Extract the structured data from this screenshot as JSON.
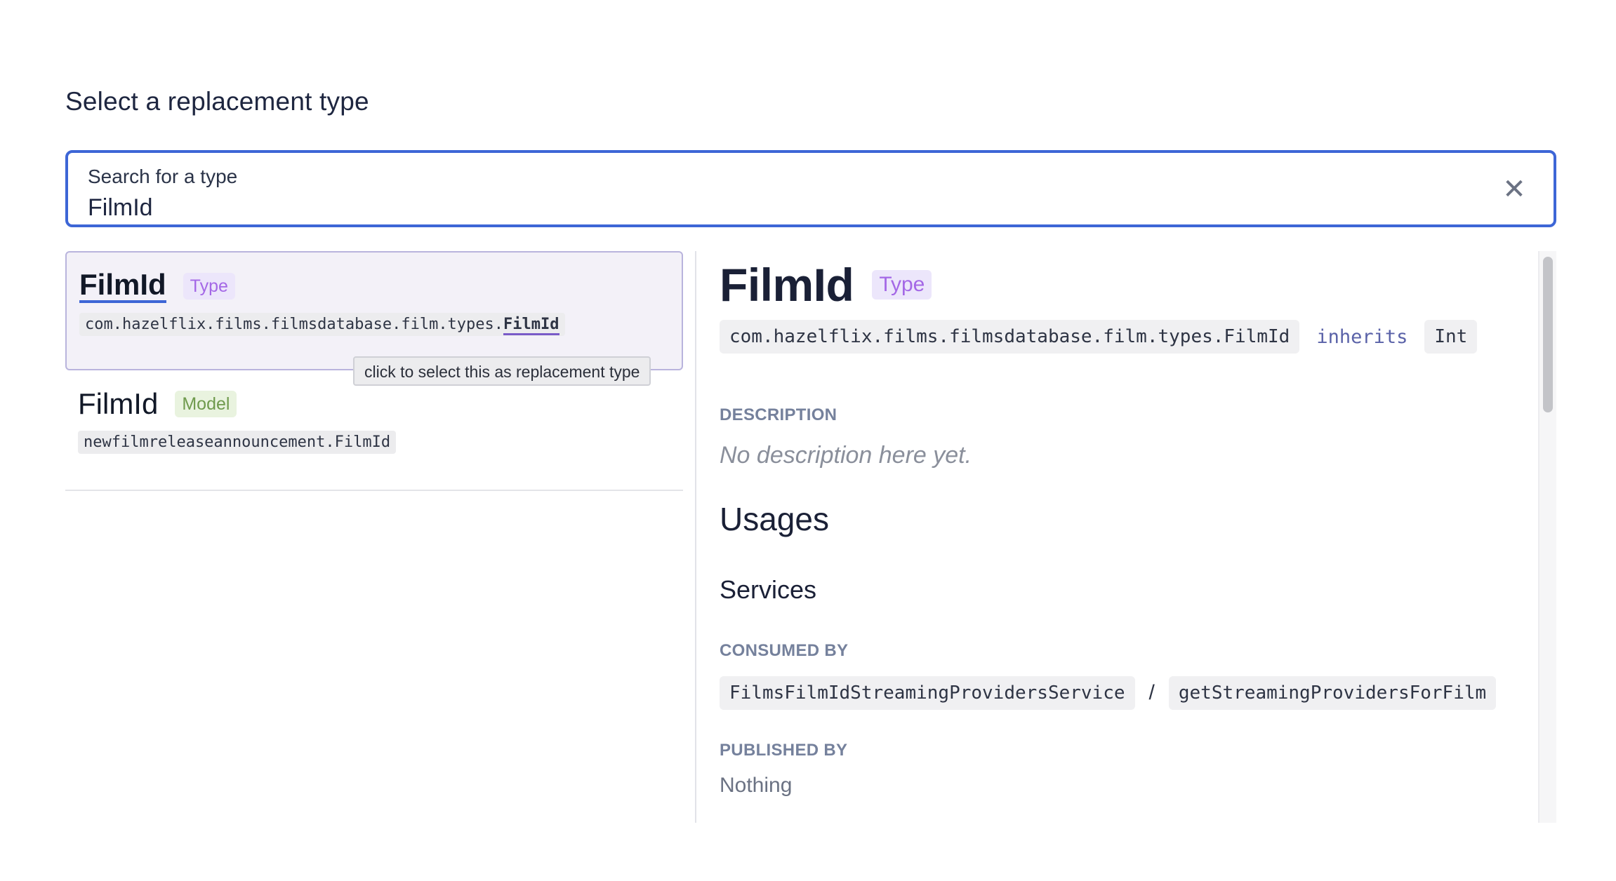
{
  "dialog": {
    "title": "Select a replacement type"
  },
  "search": {
    "label": "Search for a type",
    "value": "FilmId",
    "clear_icon": "close-icon"
  },
  "results": [
    {
      "name": "FilmId",
      "badge": "Type",
      "qualified_prefix": "com.hazelflix.films.filmsdatabase.film.types.",
      "qualified_match": "FilmId",
      "selected": true
    },
    {
      "name": "FilmId",
      "badge": "Model",
      "qualified_prefix": "newfilmreleaseannouncement.FilmId",
      "qualified_match": "",
      "selected": false
    }
  ],
  "tooltip": "click to select this as replacement type",
  "detail": {
    "name": "FilmId",
    "badge": "Type",
    "qualified": "com.hazelflix.films.filmsdatabase.film.types.FilmId",
    "inherits_label": "inherits",
    "inherits_type": "Int",
    "description_label": "DESCRIPTION",
    "description": "No description here yet.",
    "usages_heading": "Usages",
    "services_heading": "Services",
    "consumed_by_label": "CONSUMED BY",
    "consumed_service": "FilmsFilmIdStreamingProvidersService",
    "consumed_separator": "/",
    "consumed_operation": "getStreamingProvidersForFilm",
    "published_by_label": "PUBLISHED BY",
    "published_by_value": "Nothing"
  },
  "colors": {
    "accent": "#3d66d6",
    "type_badge": "#a468e6",
    "model_badge": "#6f9a4d"
  }
}
